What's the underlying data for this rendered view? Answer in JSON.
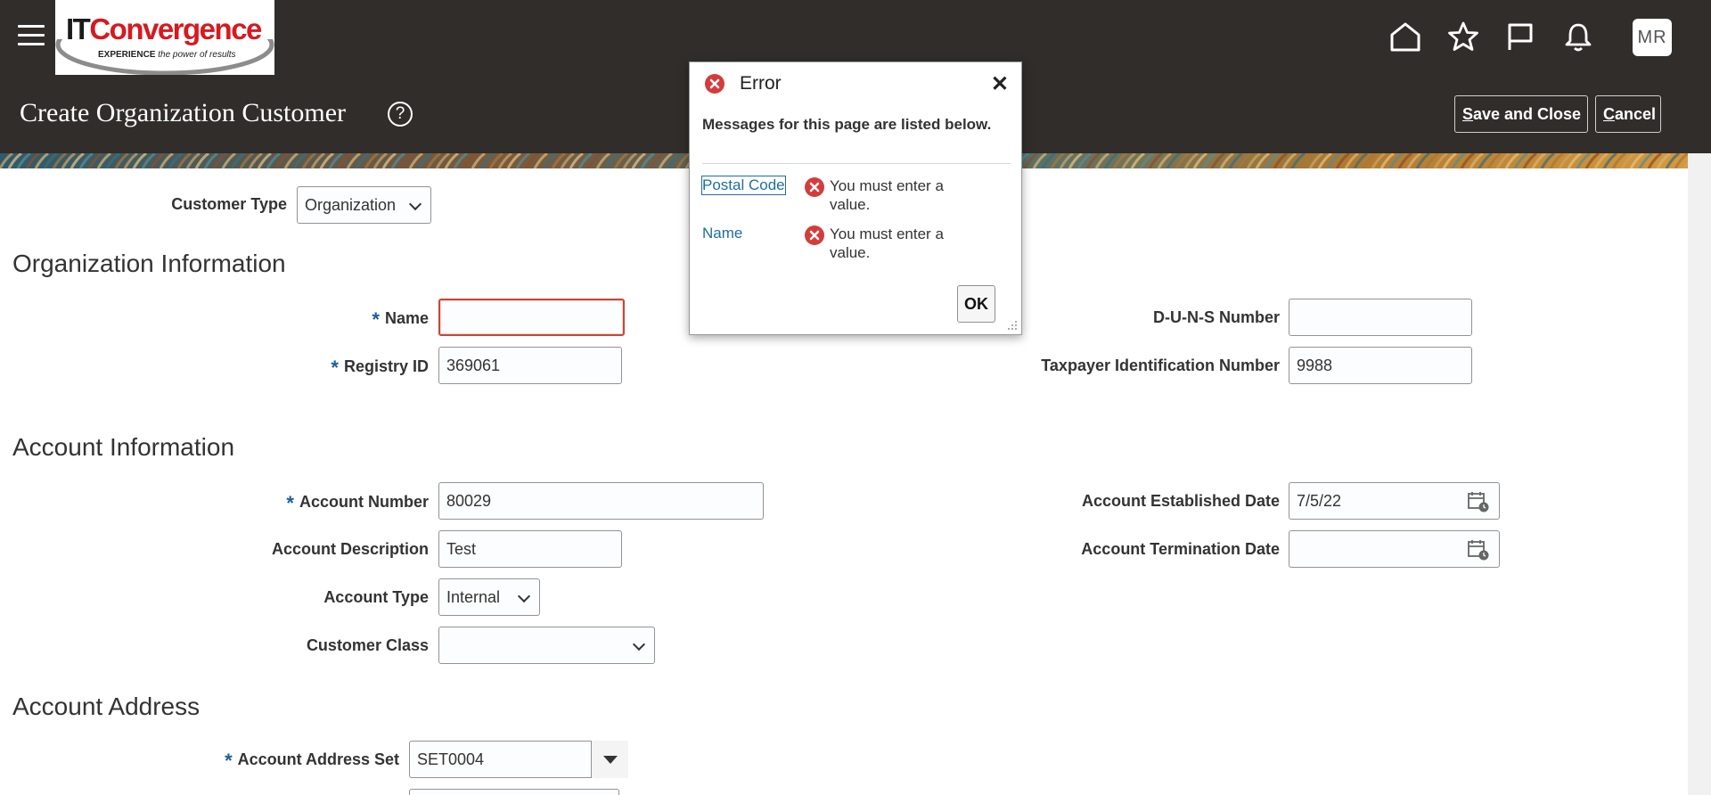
{
  "header": {
    "logo_brand_it": "IT",
    "logo_brand_conv": "Convergence",
    "logo_tag_bold": "EXPERIENCE",
    "logo_tag_rest": " the power of results",
    "avatar_initials": "MR",
    "page_title": "Create Organization Customer",
    "help_glyph": "?",
    "save_close_first": "S",
    "save_close_rest": "ave and Close",
    "cancel_first": "C",
    "cancel_rest": "ancel",
    "icons": [
      "home-icon",
      "favorites-star-icon",
      "watchlist-flag-icon",
      "notifications-bell-icon"
    ]
  },
  "form": {
    "customer_type_label": "Customer Type",
    "customer_type_value": "Organization",
    "org_section_title": "Organization Information",
    "name_label": "Name",
    "name_value": "",
    "registry_label": "Registry ID",
    "registry_value": "369061",
    "duns_label": "D-U-N-S Number",
    "duns_value": "",
    "taxpayer_label": "Taxpayer Identification Number",
    "taxpayer_value": "9988",
    "account_section_title": "Account Information",
    "account_number_label": "Account Number",
    "account_number_value": "80029",
    "account_desc_label": "Account Description",
    "account_desc_value": "Test",
    "account_type_label": "Account Type",
    "account_type_value": "Internal",
    "customer_class_label": "Customer Class",
    "customer_class_value": "",
    "established_label": "Account Established Date",
    "established_value": "7/5/22",
    "termination_label": "Account Termination Date",
    "termination_value": "",
    "address_section_title": "Account Address",
    "address_set_label": "Account Address Set",
    "address_set_value": "SET0004",
    "required_marker": "*"
  },
  "dialog": {
    "title": "Error",
    "close_glyph": "✕",
    "header": "Messages for this page are listed below.",
    "messages": [
      {
        "field": "Postal Code",
        "text": "You must enter a value."
      },
      {
        "field": "Name",
        "text": "You must enter a value."
      }
    ],
    "ok_label": "OK"
  },
  "colors": {
    "header_bg": "#312d2a",
    "error_red": "#d63b3b",
    "link_blue": "#1f6f9d",
    "required_blue": "#1a5e9b"
  }
}
